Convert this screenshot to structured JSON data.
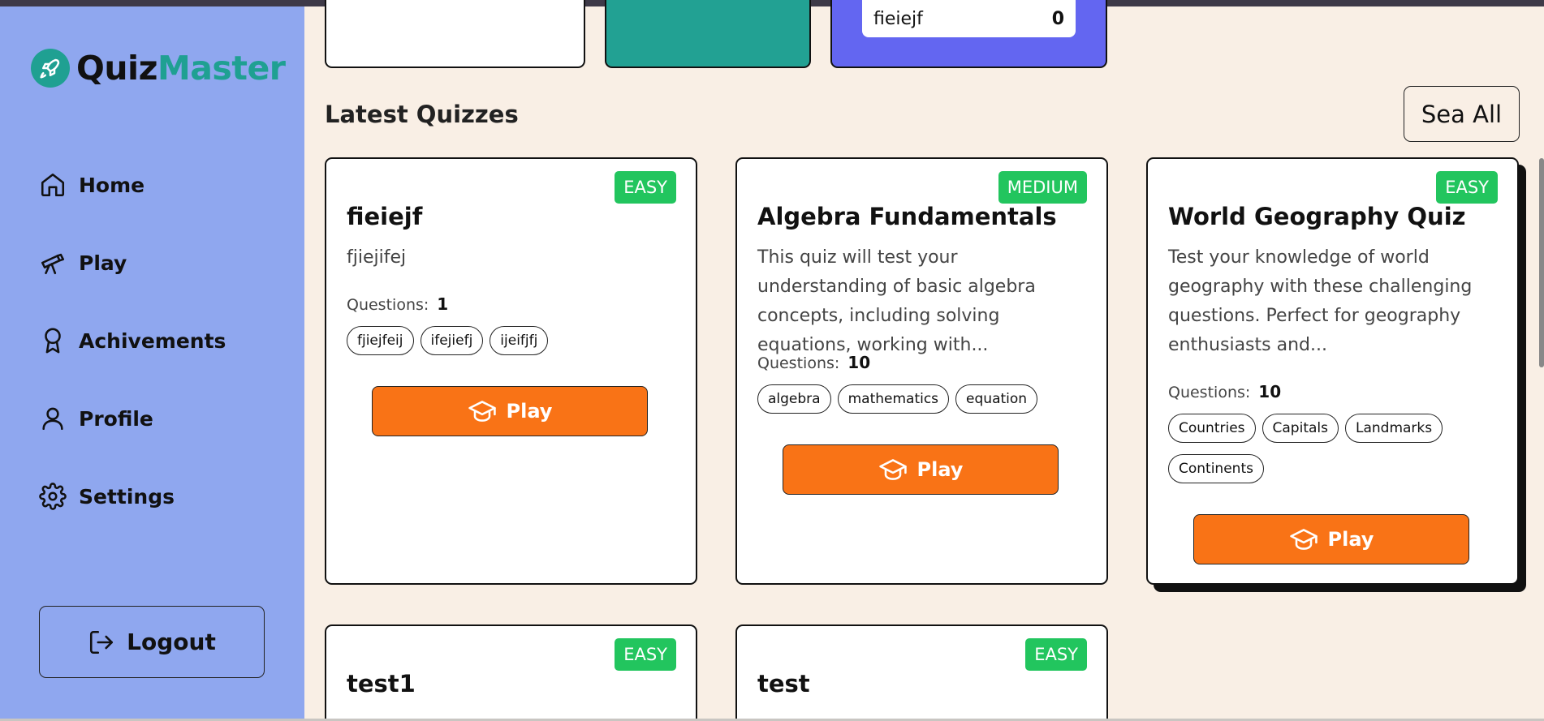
{
  "app": {
    "brand_part1": "Quiz",
    "brand_part2": "Master"
  },
  "colors": {
    "sidebar": "#8fa7ef",
    "accent_teal": "#1fa092",
    "background": "#f9efe5",
    "play_orange": "#f97316",
    "badge_green": "#22c55e",
    "stat_purple": "#6366f1"
  },
  "sidebar": {
    "items": [
      {
        "label": "Home",
        "icon": "home-icon"
      },
      {
        "label": "Play",
        "icon": "telescope-icon"
      },
      {
        "label": "Achivements",
        "icon": "award-icon"
      },
      {
        "label": "Profile",
        "icon": "user-icon"
      },
      {
        "label": "Settings",
        "icon": "gear-icon"
      }
    ],
    "logout_label": "Logout"
  },
  "leaderboard_entry": {
    "name": "fieiejf",
    "score": "0"
  },
  "latest": {
    "title": "Latest Quizzes",
    "see_all_label": "Sea All",
    "questions_label": "Questions:",
    "play_label": "Play",
    "quizzes": [
      {
        "difficulty": "EASY",
        "title": "fieiejf",
        "description": "fjiejifej",
        "questions": "1",
        "tags": [
          "fjiejfeij",
          "ifejiefj",
          "ijeifjfj"
        ]
      },
      {
        "difficulty": "MEDIUM",
        "title": "Algebra Fundamentals",
        "description": "This quiz will test your understanding of basic algebra concepts, including solving equations, working with...",
        "questions": "10",
        "tags": [
          "algebra",
          "mathematics",
          "equation"
        ]
      },
      {
        "difficulty": "EASY",
        "title": "World Geography Quiz",
        "description": "Test your knowledge of world geography with these challenging questions. Perfect for geography enthusiasts and...",
        "questions": "10",
        "tags": [
          "Countries",
          "Capitals",
          "Landmarks",
          "Continents"
        ]
      },
      {
        "difficulty": "EASY",
        "title": "test1"
      },
      {
        "difficulty": "EASY",
        "title": "test"
      }
    ]
  }
}
